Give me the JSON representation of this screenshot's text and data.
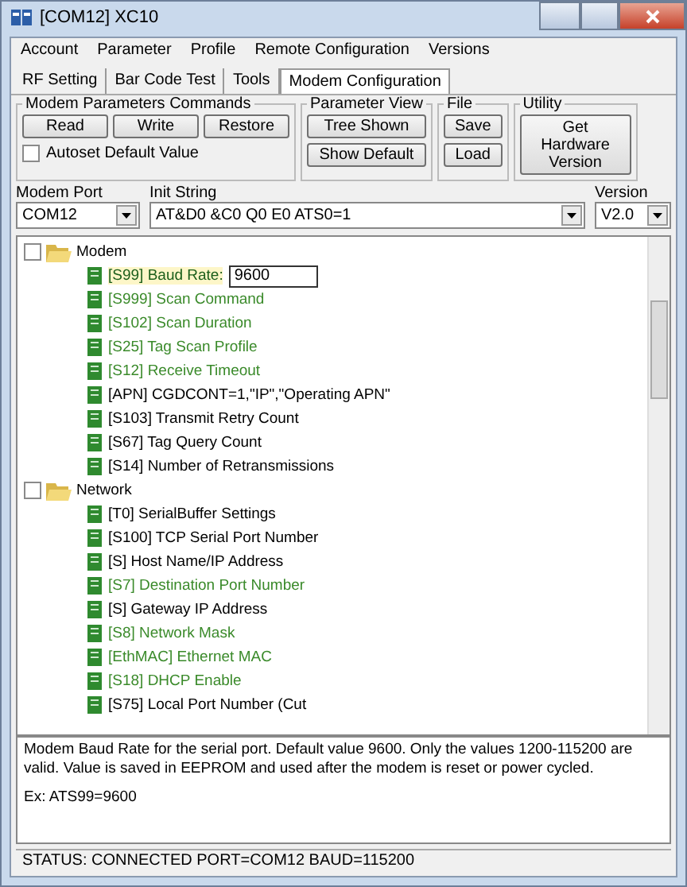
{
  "window": {
    "title": "[COM12] XC10"
  },
  "menu": [
    "Account",
    "Parameter",
    "Profile",
    "Remote Configuration",
    "Versions"
  ],
  "tabs": [
    {
      "label": "RF Setting",
      "selected": false
    },
    {
      "label": "Bar Code Test",
      "selected": false
    },
    {
      "label": "Tools",
      "selected": false
    },
    {
      "label": "Modem Configuration",
      "selected": true
    }
  ],
  "groups": [
    {
      "title": "Modem Parameters Commands",
      "buttons": [
        "Read",
        "Write",
        "Restore"
      ],
      "checkbox": {
        "label": "Autoset Default Value",
        "checked": false
      }
    },
    {
      "title": "Parameter View",
      "buttons": [
        "Tree Shown",
        "Show Default"
      ]
    },
    {
      "title": "File",
      "buttons": [
        "Save",
        "Load"
      ]
    },
    {
      "title": "Utility",
      "buttons": [
        "Get Hardware Version"
      ]
    }
  ],
  "selectors": [
    {
      "label": "Modem Port",
      "value": "COM12"
    },
    {
      "label": "Init String",
      "value": "AT&D0 &C0 Q0 E0 ATS0=1"
    },
    {
      "label": "Version",
      "value": "V2.0"
    }
  ],
  "tree": [
    {
      "label": "Modem",
      "expanded": true,
      "checked": false,
      "children": [
        {
          "label": "[S99] Baud Rate:",
          "selected": true,
          "color": "#1a5e1a",
          "edit_value": "9600"
        },
        {
          "label": "[S999] Scan Command",
          "selected": false,
          "color": "#3a8a2a"
        },
        {
          "label": "[S102] Scan Duration",
          "selected": false,
          "color": "#3a8a2a"
        },
        {
          "label": "[S25] Tag Scan Profile",
          "selected": false,
          "color": "#3a8a2a"
        },
        {
          "label": "[S12] Receive Timeout",
          "selected": false,
          "color": "#3a8a2a"
        },
        {
          "label": "[APN] CGDCONT=1,\"IP\",\"Operating APN\"",
          "selected": false,
          "color": "#000000"
        },
        {
          "label": "[S103] Transmit Retry Count",
          "selected": false,
          "color": "#000000"
        },
        {
          "label": "[S67] Tag Query Count",
          "selected": false,
          "color": "#000000"
        },
        {
          "label": "[S14] Number of Retransmissions",
          "selected": false,
          "color": "#000000"
        }
      ]
    },
    {
      "label": "Network",
      "expanded": true,
      "checked": false,
      "children": [
        {
          "label": "[T0] SerialBuffer Settings",
          "selected": false,
          "color": "#000000"
        },
        {
          "label": "[S100] TCP Serial Port Number",
          "selected": false,
          "color": "#000000"
        },
        {
          "label": "[S] Host Name/IP Address",
          "selected": false,
          "color": "#000000"
        },
        {
          "label": "[S7] Destination Port Number",
          "selected": false,
          "color": "#3a8a2a"
        },
        {
          "label": "[S] Gateway IP Address",
          "selected": false,
          "color": "#000000"
        },
        {
          "label": "[S8] Network Mask",
          "selected": false,
          "color": "#3a8a2a"
        },
        {
          "label": "[EthMAC] Ethernet MAC",
          "selected": false,
          "color": "#3a8a2a"
        },
        {
          "label": "[S18] DHCP Enable",
          "selected": false,
          "color": "#3a8a2a"
        },
        {
          "label": "[S75] Local Port Number (Cut",
          "selected": false,
          "color": "#000000"
        }
      ]
    }
  ],
  "description": [
    "Modem Baud Rate for the serial port. Default value 9600. Only the values 1200-115200 are valid. Value is saved in EEPROM and used after the modem is reset or power cycled.",
    "Ex: ATS99=9600"
  ],
  "status_bar": "STATUS: CONNECTED  PORT=COM12  BAUD=115200"
}
